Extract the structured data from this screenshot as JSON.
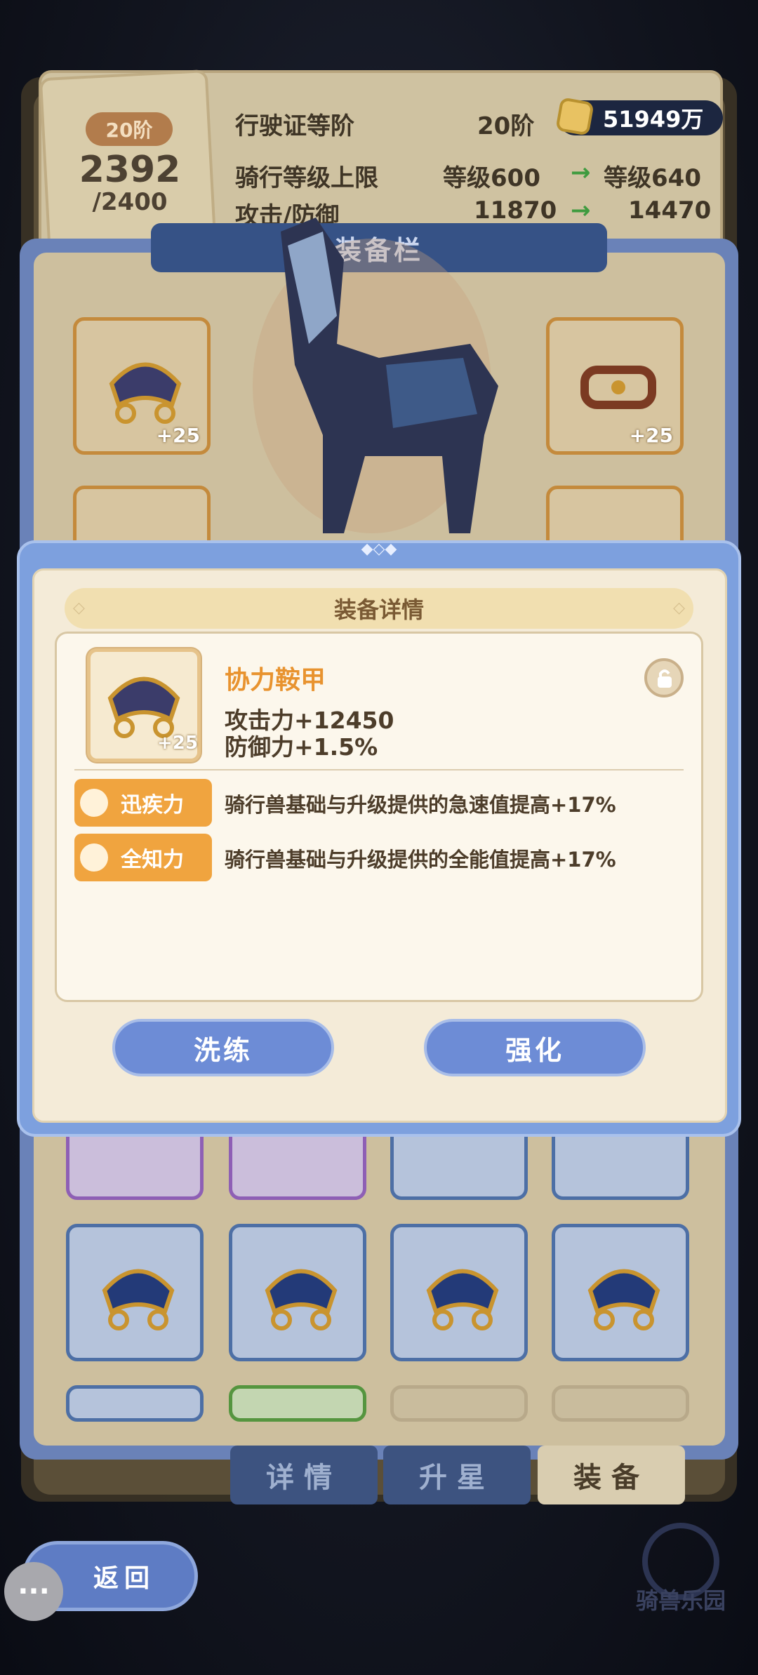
{
  "stats": {
    "level_tag": "20阶",
    "level_current": "2392",
    "level_max": "/2400",
    "license_label": "行驶证等阶",
    "license_value": "20阶",
    "coin_amount": "51949万",
    "ride_limit_label": "骑行等级上限",
    "ride_limit_from": "等级600",
    "ride_limit_to": "等级640",
    "atk_def_label": "攻击/防御",
    "atk_def_from": "11870",
    "atk_def_to": "14470",
    "arrow": "→"
  },
  "equip": {
    "title": "装备栏",
    "slot_plus": "+25"
  },
  "tabs": [
    {
      "label": "详情"
    },
    {
      "label": "升星"
    },
    {
      "label": "装备"
    }
  ],
  "return_label": "返回",
  "watermark": "骑兽乐园",
  "popup": {
    "title": "装备详情",
    "item_name": "协力鞍甲",
    "item_plus": "+25",
    "attack": "攻击力+12450",
    "defense": "防御力+1.5%",
    "skills": [
      {
        "name": "迅疾力",
        "desc": "骑行兽基础与升级提供的急速值提高+17%"
      },
      {
        "name": "全知力",
        "desc": "骑行兽基础与升级提供的全能值提高+17%"
      }
    ],
    "btn_refine": "洗练",
    "btn_enhance": "强化"
  },
  "colors": {
    "accent_orange": "#e8932f",
    "button_blue": "#6d8cd6",
    "popup_frame": "#7da0de"
  }
}
